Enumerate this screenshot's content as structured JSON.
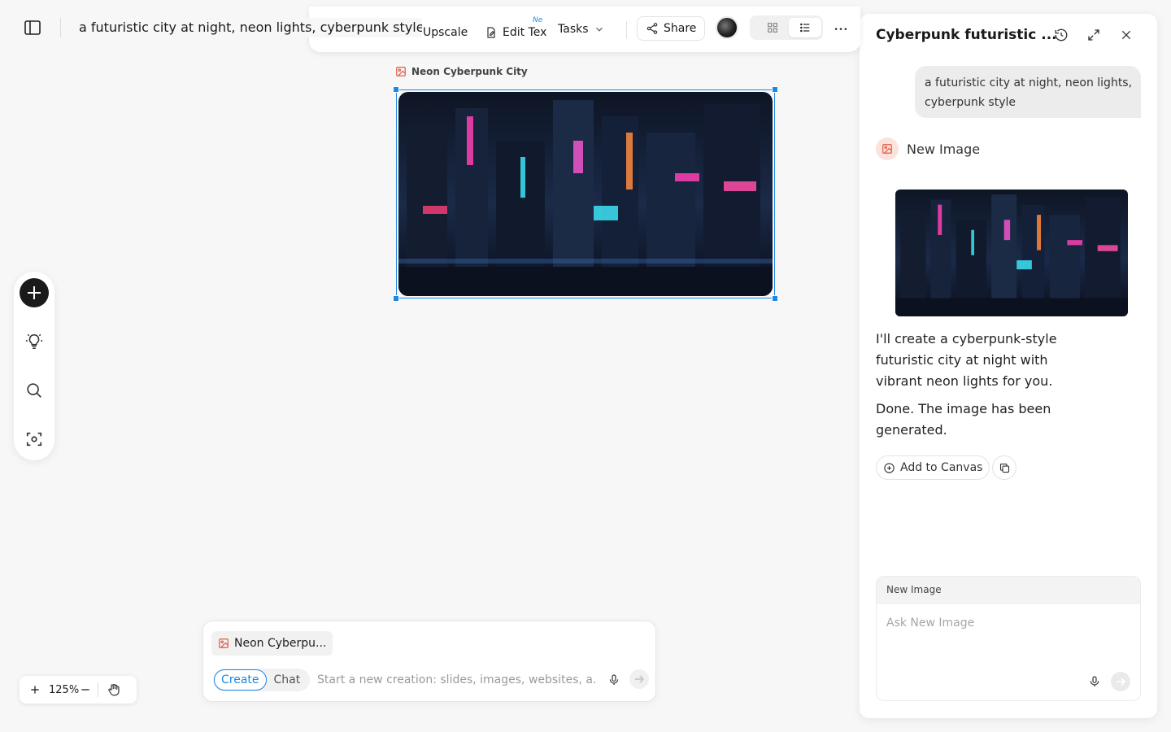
{
  "header": {
    "doc_title": "a futuristic city at night, neon lights, cyberpunk style"
  },
  "toolbar": {
    "upscale_label": "Upscale",
    "edit_text_label": "Edit Tex",
    "new_badge": "Ne",
    "tasks_label": "Tasks",
    "share_label": "Share"
  },
  "canvas": {
    "frame_label": "Neon Cyberpunk City"
  },
  "zoom": {
    "level": "125%"
  },
  "composer": {
    "chip_label": "Neon Cyberpu...",
    "mode_create": "Create",
    "mode_chat": "Chat",
    "placeholder": "Start a new creation: slides, images, websites, a..."
  },
  "panel": {
    "title": "Cyberpunk futuristic ...",
    "user_message": "a futuristic city at night, neon lights, cyberpunk style",
    "tool_label": "New Image",
    "ai_message_1": "I'll create a cyberpunk-style futuristic city at night with vibrant neon lights for you.",
    "ai_message_2": "Done. The image has been generated.",
    "add_to_canvas": "Add to Canvas",
    "composer_header": "New Image",
    "composer_placeholder": "Ask New Image"
  },
  "colors": {
    "accent": "#1e88e5",
    "background": "#f7f7f7",
    "icon_orange": "#e2583e"
  }
}
